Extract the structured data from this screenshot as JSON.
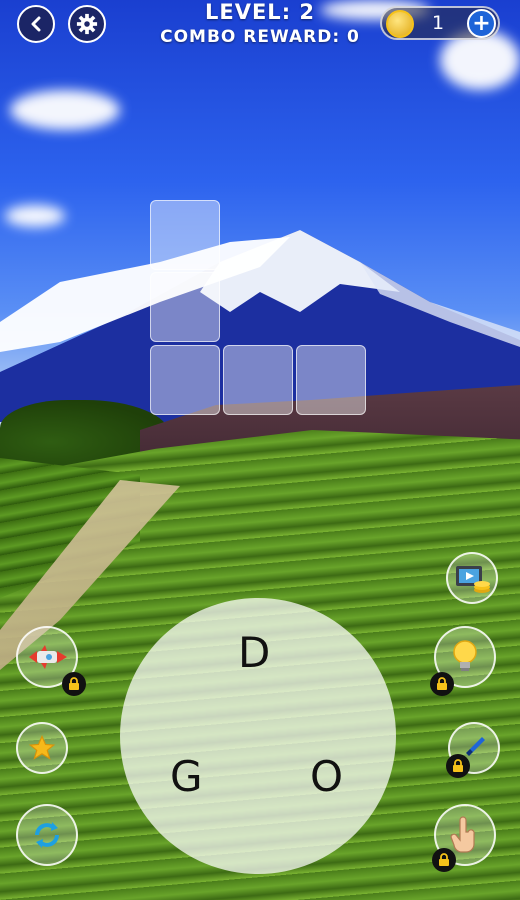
{
  "header": {
    "level_text": "LEVEL: 2",
    "combo_text": "COMBO REWARD: 0",
    "coins": "1",
    "plus_label": "+"
  },
  "wheel": {
    "letters": [
      "D",
      "G",
      "O"
    ]
  },
  "icons": {
    "back": "back-arrow-icon",
    "settings": "gear-icon",
    "coin": "coin-icon",
    "video_reward": "video-coins-icon",
    "rocket": "rocket-icon",
    "hint": "lightbulb-icon",
    "star": "star-icon",
    "brush": "brush-icon",
    "shuffle": "shuffle-icon",
    "finger": "pointing-hand-icon",
    "lock": "lock-icon"
  },
  "colors": {
    "button_navy": "#1b2566",
    "plus_blue": "#1e64d8",
    "coin_gold": "#f6c21a"
  }
}
